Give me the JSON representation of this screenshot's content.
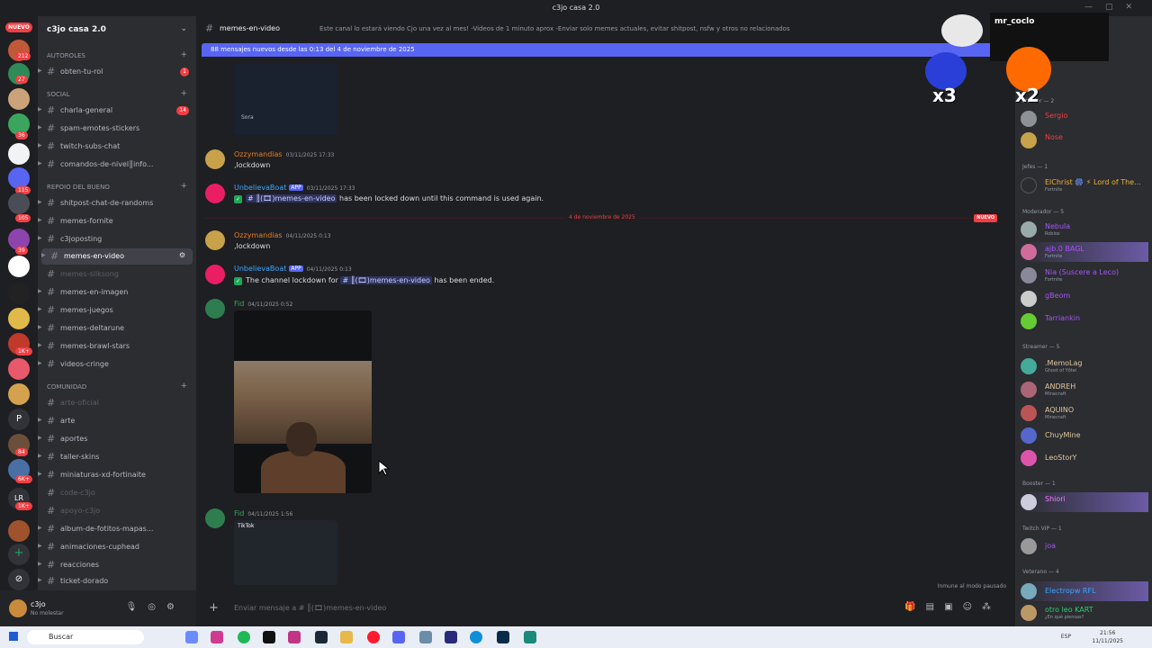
{
  "window": {
    "title": "c3jo casa 2.0"
  },
  "servers": {
    "nuevo": "NUEVO",
    "badges": [
      "212",
      "27",
      "36",
      "115",
      "105",
      "39",
      "1K+",
      "84",
      "6K+",
      "1K+"
    ],
    "letters": [
      "P",
      "LR"
    ]
  },
  "guild": {
    "name": "c3jo casa 2.0"
  },
  "categories": {
    "autoroles": "AUTOROLES",
    "social": "SOCIAL",
    "repoio": "REPOIO DEL BUENO",
    "comunidad": "COMUNIDAD"
  },
  "channels": [
    {
      "label": "obten-tu-rol",
      "badge": "1"
    },
    {
      "label": "charla-general",
      "badge": "14"
    },
    {
      "label": "spam-emotes-stickers"
    },
    {
      "label": "twitch-subs-chat"
    },
    {
      "label": "comandos-de-nivel║info..."
    },
    {
      "label": "shitpost-chat-de-randoms"
    },
    {
      "label": "memes-fornite"
    },
    {
      "label": "c3joposting"
    },
    {
      "label": "memes-en-video"
    },
    {
      "label": "memes-silksong"
    },
    {
      "label": "memes-en-imagen"
    },
    {
      "label": "memes-juegos"
    },
    {
      "label": "memes-deltarune"
    },
    {
      "label": "memes-brawl-stars"
    },
    {
      "label": "videos-cringe"
    },
    {
      "label": "arte-oficial"
    },
    {
      "label": "arte"
    },
    {
      "label": "aportes"
    },
    {
      "label": "taller-skins"
    },
    {
      "label": "miniaturas-xd-fortinaite"
    },
    {
      "label": "code-c3jo"
    },
    {
      "label": "apoyo-c3jo"
    },
    {
      "label": "album-de-fotitos-mapas..."
    },
    {
      "label": "animaciones-cuphead"
    },
    {
      "label": "reacciones"
    },
    {
      "label": "ticket-dorado"
    }
  ],
  "user": {
    "name": "c3jo",
    "status": "No molestar"
  },
  "header": {
    "channel": "memes-en-video",
    "topic": "Este canal lo estará viendo Cjo una vez al mes! -Videos de 1 minuto aprox -Enviar solo memes actuales, evitar shitpost, nsfw y otros no relacionados"
  },
  "new_bar": "88 mensajes nuevos desde las 0:13 del 4 de noviembre de 2025",
  "embed": {
    "sora": "Sora"
  },
  "messages": {
    "m1": {
      "author": "Ozzymandias",
      "time": "03/11/2025 17:33",
      "text": ",lockdown"
    },
    "m2": {
      "author": "UnbelievaBoat",
      "app": "APP",
      "time": "03/11/2025 17:33",
      "channel": "memes-en-video",
      "text": "has been locked down until this command is used again."
    },
    "m3": {
      "author": "Ozzymandias",
      "time": "04/11/2025 0:13",
      "text": ",lockdown"
    },
    "m4": {
      "author": "UnbelievaBoat",
      "app": "APP",
      "time": "04/11/2025 0:13",
      "prefix": "The channel lockdown for",
      "channel": "memes-en-video",
      "text": "has been ended."
    },
    "m5": {
      "author": "Fid",
      "time": "04/11/2025 0:52"
    },
    "m6": {
      "author": "Fid",
      "time": "04/11/2025 1:56",
      "tiktok": "TikTok"
    }
  },
  "date_separator": {
    "label": "4 de noviembre de 2025",
    "nuevo": "NUEVO"
  },
  "composer": {
    "placeholder": "Enviar mensaje a # ║(🎞)memes-en-video",
    "paused": "Inmune al modo pausado"
  },
  "members": {
    "groups": {
      "admin": "strador — 2",
      "jefes": "Jefes — 1",
      "moderador": "Moderador — 5",
      "streamer": "Streamer — 5",
      "booster": "Booster — 1",
      "twitch_vip": "Twitch VIP — 1",
      "veterano": "Veterano — 4"
    },
    "list": [
      {
        "name": "Sergio",
        "sub": ""
      },
      {
        "name": "Nose",
        "sub": ""
      },
      {
        "name": "ElChrist 🎆 ⚡ Lord of The...",
        "sub": "Fortnite"
      },
      {
        "name": "Nebula",
        "sub": "Roblox"
      },
      {
        "name": "ajb.0 BAGL",
        "sub": "Fortnite"
      },
      {
        "name": "Nia (Suscere a Leco)",
        "sub": "Fortnite"
      },
      {
        "name": "gBeom",
        "sub": ""
      },
      {
        "name": "Tarriankin",
        "sub": ""
      },
      {
        "name": ".MemoLag",
        "sub": "Ghost of Yōtei"
      },
      {
        "name": "ANDREH",
        "sub": "Minecraft"
      },
      {
        "name": "AQUINO",
        "sub": "Minecraft"
      },
      {
        "name": "ChuyMine",
        "sub": ""
      },
      {
        "name": "LeoStorY",
        "sub": ""
      },
      {
        "name": "Shiori",
        "sub": ""
      },
      {
        "name": "joa",
        "sub": ""
      },
      {
        "name": "Electropw RFL",
        "sub": ""
      },
      {
        "name": "otro leo KART",
        "sub": "¿En qué piensas?"
      }
    ]
  },
  "overlay": {
    "username": "mr_coclo",
    "x3": "x3",
    "x2": "x2"
  },
  "taskbar": {
    "search": "Buscar",
    "lang": "ESP",
    "time": "21:56",
    "date": "11/11/2025"
  }
}
